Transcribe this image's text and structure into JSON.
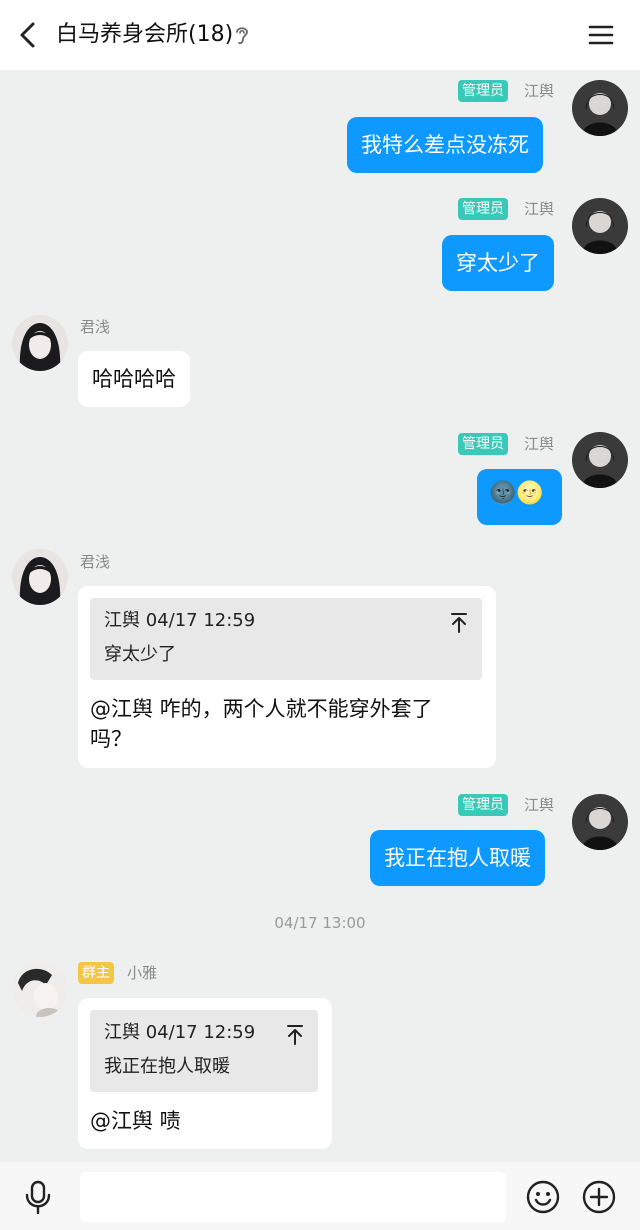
{
  "header": {
    "title": "白马养身会所(18)"
  },
  "messages": [
    {
      "sender": "江舆",
      "badge": "管理员",
      "text": "我特么差点没冻死"
    },
    {
      "sender": "江舆",
      "badge": "管理员",
      "text": "穿太少了"
    },
    {
      "sender": "君浅",
      "text": "哈哈哈哈"
    },
    {
      "sender": "江舆",
      "badge": "管理员",
      "emoji": "🌚🌝"
    },
    {
      "sender": "君浅",
      "quote": {
        "meta": "江舆 04/17 12:59",
        "text": "穿太少了"
      },
      "text_line1": "@江舆 咋的，两个人就不能穿外套了",
      "text_line2": "吗？"
    },
    {
      "sender": "江舆",
      "badge": "管理员",
      "text": "我正在抱人取暖"
    },
    {
      "sender": "小雅",
      "badge": "群主",
      "quote": {
        "meta": "江舆 04/17 12:59",
        "text": "我正在抱人取暖"
      },
      "text": "@江舆 啧"
    }
  ],
  "timestamp": "04/17 13:00",
  "colors": {
    "outgoing_bubble": "#0d99ff",
    "admin_badge": "#38c9b8",
    "owner_badge": "#f6c544",
    "background": "#edf0ee"
  },
  "icons": [
    "back-arrow",
    "ear-icon",
    "menu-icon",
    "mic-icon",
    "emoji-icon",
    "plus-icon"
  ]
}
